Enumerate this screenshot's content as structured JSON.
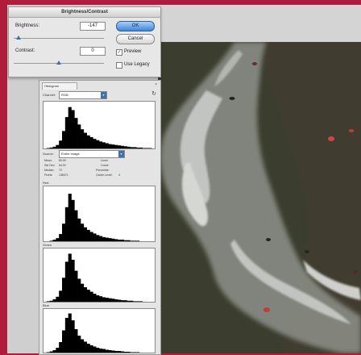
{
  "brightness_dialog": {
    "title": "Brightness/Contrast",
    "brightness_label": "Brightness:",
    "brightness_value": "-147",
    "brightness_level": 0.05,
    "contrast_label": "Contrast:",
    "contrast_value": "0",
    "contrast_level": 0.5,
    "ok_label": "OK",
    "cancel_label": "Cancel",
    "preview_label": "Preview",
    "preview_checked": true,
    "legacy_label": "Use Legacy",
    "legacy_checked": false
  },
  "histogram_panel": {
    "tab_label": "Histogram",
    "close_glyph": "×",
    "channel_label": "Channel:",
    "channel_value": "RGB",
    "source_label": "Source:",
    "source_value": "Entire Image",
    "stats": {
      "mean_label": "Mean:",
      "mean_value": "80.09",
      "std_label": "Std Dev:",
      "std_value": "54.02",
      "median_label": "Median:",
      "median_value": "72",
      "pixels_label": "Pixels:",
      "pixels_value": "138471",
      "level_label": "Level:",
      "count_label": "Count:",
      "percentile_label": "Percentile:",
      "cache_label": "Cache Level:",
      "cache_value": "4"
    },
    "red_label": "Red",
    "green_label": "Green",
    "blue_label": "Blue",
    "hist_shapes": {
      "rgb": [
        0,
        1,
        2,
        4,
        8,
        18,
        40,
        72,
        95,
        88,
        70,
        55,
        44,
        36,
        30,
        26,
        22,
        19,
        16,
        14,
        12,
        10,
        9,
        8,
        7,
        6,
        5,
        4,
        3,
        3,
        2,
        2,
        1,
        1,
        1,
        0
      ],
      "red": [
        0,
        0,
        1,
        3,
        6,
        14,
        34,
        66,
        92,
        80,
        60,
        44,
        34,
        27,
        22,
        18,
        15,
        12,
        10,
        8,
        7,
        6,
        5,
        4,
        3,
        3,
        2,
        2,
        1,
        1,
        1,
        0,
        0,
        0,
        0,
        0
      ],
      "green": [
        0,
        1,
        2,
        5,
        10,
        22,
        48,
        80,
        96,
        84,
        62,
        46,
        36,
        29,
        24,
        20,
        16,
        13,
        11,
        9,
        8,
        7,
        6,
        5,
        4,
        3,
        3,
        2,
        2,
        1,
        1,
        1,
        0,
        0,
        0,
        0
      ],
      "blue": [
        0,
        1,
        3,
        6,
        12,
        26,
        55,
        86,
        97,
        80,
        58,
        42,
        33,
        27,
        22,
        18,
        15,
        12,
        10,
        9,
        7,
        6,
        5,
        4,
        4,
        3,
        2,
        2,
        1,
        1,
        1,
        0,
        0,
        0,
        0,
        0
      ]
    }
  },
  "colors": {
    "frame": "#b01c3c",
    "sea": "#3a3d2c",
    "foam": "#c9ccc8",
    "accent": "#3f6fb5"
  }
}
